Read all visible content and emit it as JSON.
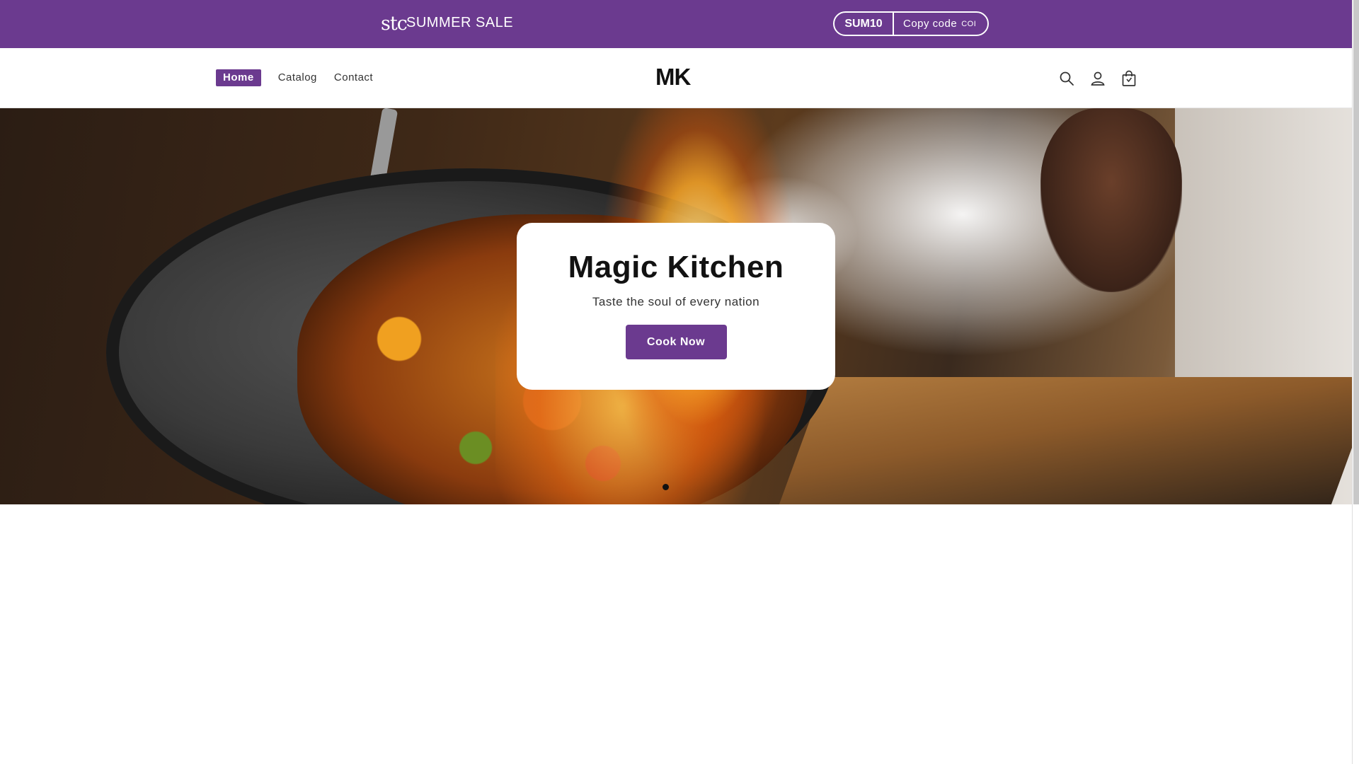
{
  "announcement": {
    "logo_text": "stc",
    "sale_text": "SUMMER SALE",
    "coupon_code": "SUM10",
    "copy_label": "Copy code",
    "copy_tail": "COI",
    "background_color": "#6b3a8f"
  },
  "header": {
    "nav": [
      {
        "label": "Home",
        "active": true
      },
      {
        "label": "Catalog",
        "active": false
      },
      {
        "label": "Contact",
        "active": false
      }
    ],
    "brand": "MK",
    "icons": [
      "search-icon",
      "account-icon",
      "cart-icon"
    ]
  },
  "hero": {
    "title": "Magic Kitchen",
    "subtitle": "Taste the soul of every nation",
    "cta_label": "Cook Now",
    "accent_color": "#6b3a8f"
  }
}
